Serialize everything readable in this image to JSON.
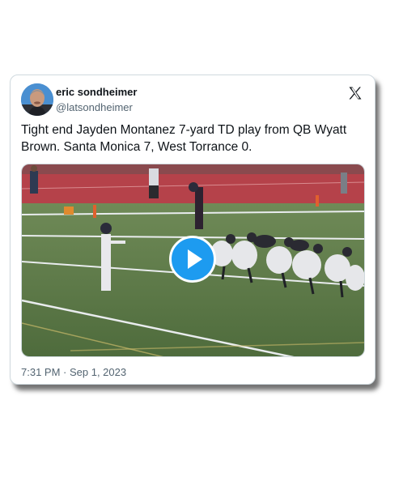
{
  "author": {
    "display_name": "eric sondheimer",
    "handle": "@latsondheimer"
  },
  "tweet": {
    "text": "Tight end Jayden Montanez 7-yard TD play from QB Wyatt Brown. Santa Monica 7, West Torrance 0.",
    "timestamp": "7:31 PM · Sep 1, 2023"
  },
  "icons": {
    "brand": "x-logo-icon",
    "play": "play-icon"
  },
  "colors": {
    "accent": "#1d9bf0",
    "text": "#0f1419",
    "secondary_text": "#536471",
    "field_green": "#5b7a45",
    "track_red": "#b5424a"
  }
}
